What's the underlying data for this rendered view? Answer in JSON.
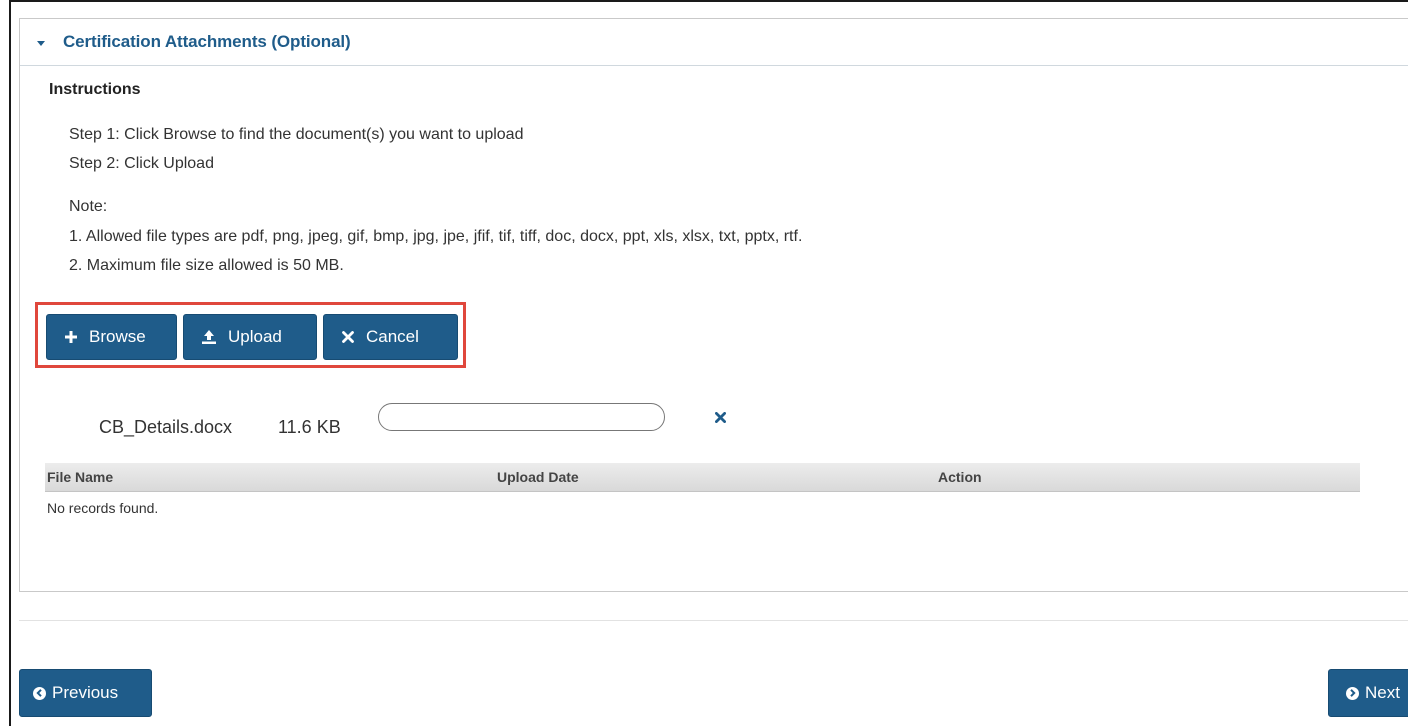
{
  "panel": {
    "title": "Certification Attachments (Optional)"
  },
  "instructions": {
    "heading": "Instructions",
    "steps": [
      "Step 1: Click Browse to find the document(s) you want to upload",
      "Step 2: Click Upload"
    ],
    "note_label": "Note:",
    "notes": [
      "1. Allowed file types are pdf, png, jpeg, gif, bmp, jpg, jpe, jfif, tif, tiff, doc, docx, ppt, xls, xlsx, txt, pptx, rtf.",
      "2. Maximum file size allowed is 50 MB."
    ]
  },
  "toolbar": {
    "browse_label": "Browse",
    "upload_label": "Upload",
    "cancel_label": "Cancel",
    "highlight_color": "#e0473c"
  },
  "pending_file": {
    "name": "CB_Details.docx",
    "size": "11.6 KB",
    "progress": 0
  },
  "table": {
    "columns": [
      "File Name",
      "Upload Date",
      "Action"
    ],
    "empty_message": "No records found."
  },
  "navigation": {
    "previous_label": "Previous",
    "next_label": "Next"
  },
  "colors": {
    "primary": "#1f5c8a"
  },
  "icons": {
    "panel_toggle": "caret-down-icon",
    "browse": "plus-icon",
    "upload": "upload-icon",
    "cancel": "times-icon",
    "remove_file": "times-icon",
    "previous": "circle-chevron-left-icon",
    "next": "circle-chevron-right-icon"
  }
}
